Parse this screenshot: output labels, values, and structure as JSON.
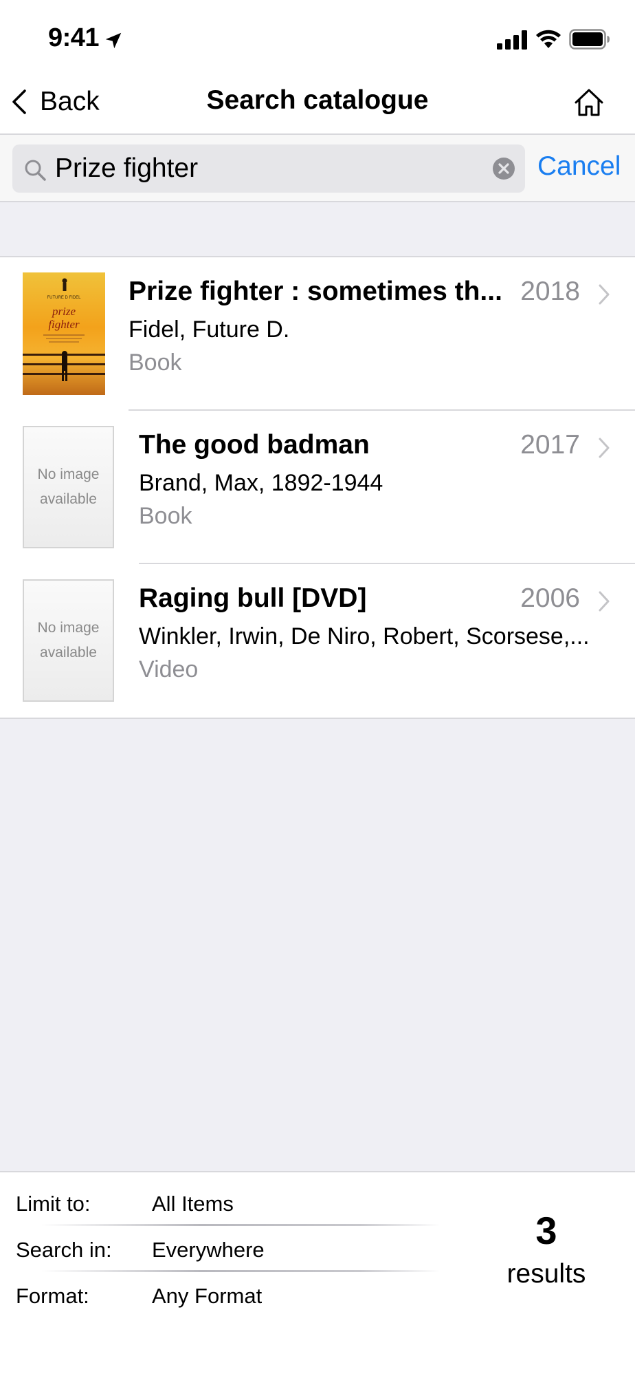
{
  "status_bar": {
    "time": "9:41",
    "location_icon": "location-arrow-icon",
    "signal_icon": "cellular-signal-icon",
    "wifi_icon": "wifi-icon",
    "battery_icon": "battery-icon"
  },
  "nav": {
    "back_label": "Back",
    "title": "Search catalogue",
    "home_icon": "home-icon"
  },
  "search": {
    "value": "Prize fighter",
    "cancel_label": "Cancel"
  },
  "results": [
    {
      "title": "Prize fighter : sometimes th...",
      "year": "2018",
      "author": "Fidel, Future D.",
      "format": "Book",
      "has_cover": true,
      "cover_text": {
        "author": "FUTURE D FIDEL",
        "title_line1": "prize",
        "title_line2": "fighter"
      }
    },
    {
      "title": "The good badman",
      "year": "2017",
      "author": "Brand, Max, 1892-1944",
      "format": "Book",
      "has_cover": false,
      "no_image_line1": "No image",
      "no_image_line2": "available"
    },
    {
      "title": "Raging bull [DVD]",
      "year": "2006",
      "author": "Winkler, Irwin, De Niro, Robert, Scorsese,...",
      "format": "Video",
      "has_cover": false,
      "no_image_line1": "No image",
      "no_image_line2": "available"
    }
  ],
  "filters": {
    "limit_label": "Limit to:",
    "limit_value": "All Items",
    "search_in_label": "Search in:",
    "search_in_value": "Everywhere",
    "format_label": "Format:",
    "format_value": "Any Format"
  },
  "summary": {
    "count": "3",
    "label": "results"
  },
  "colors": {
    "accent": "#1a7ef0",
    "secondary_text": "#8e8e93",
    "background": "#efeff4"
  }
}
